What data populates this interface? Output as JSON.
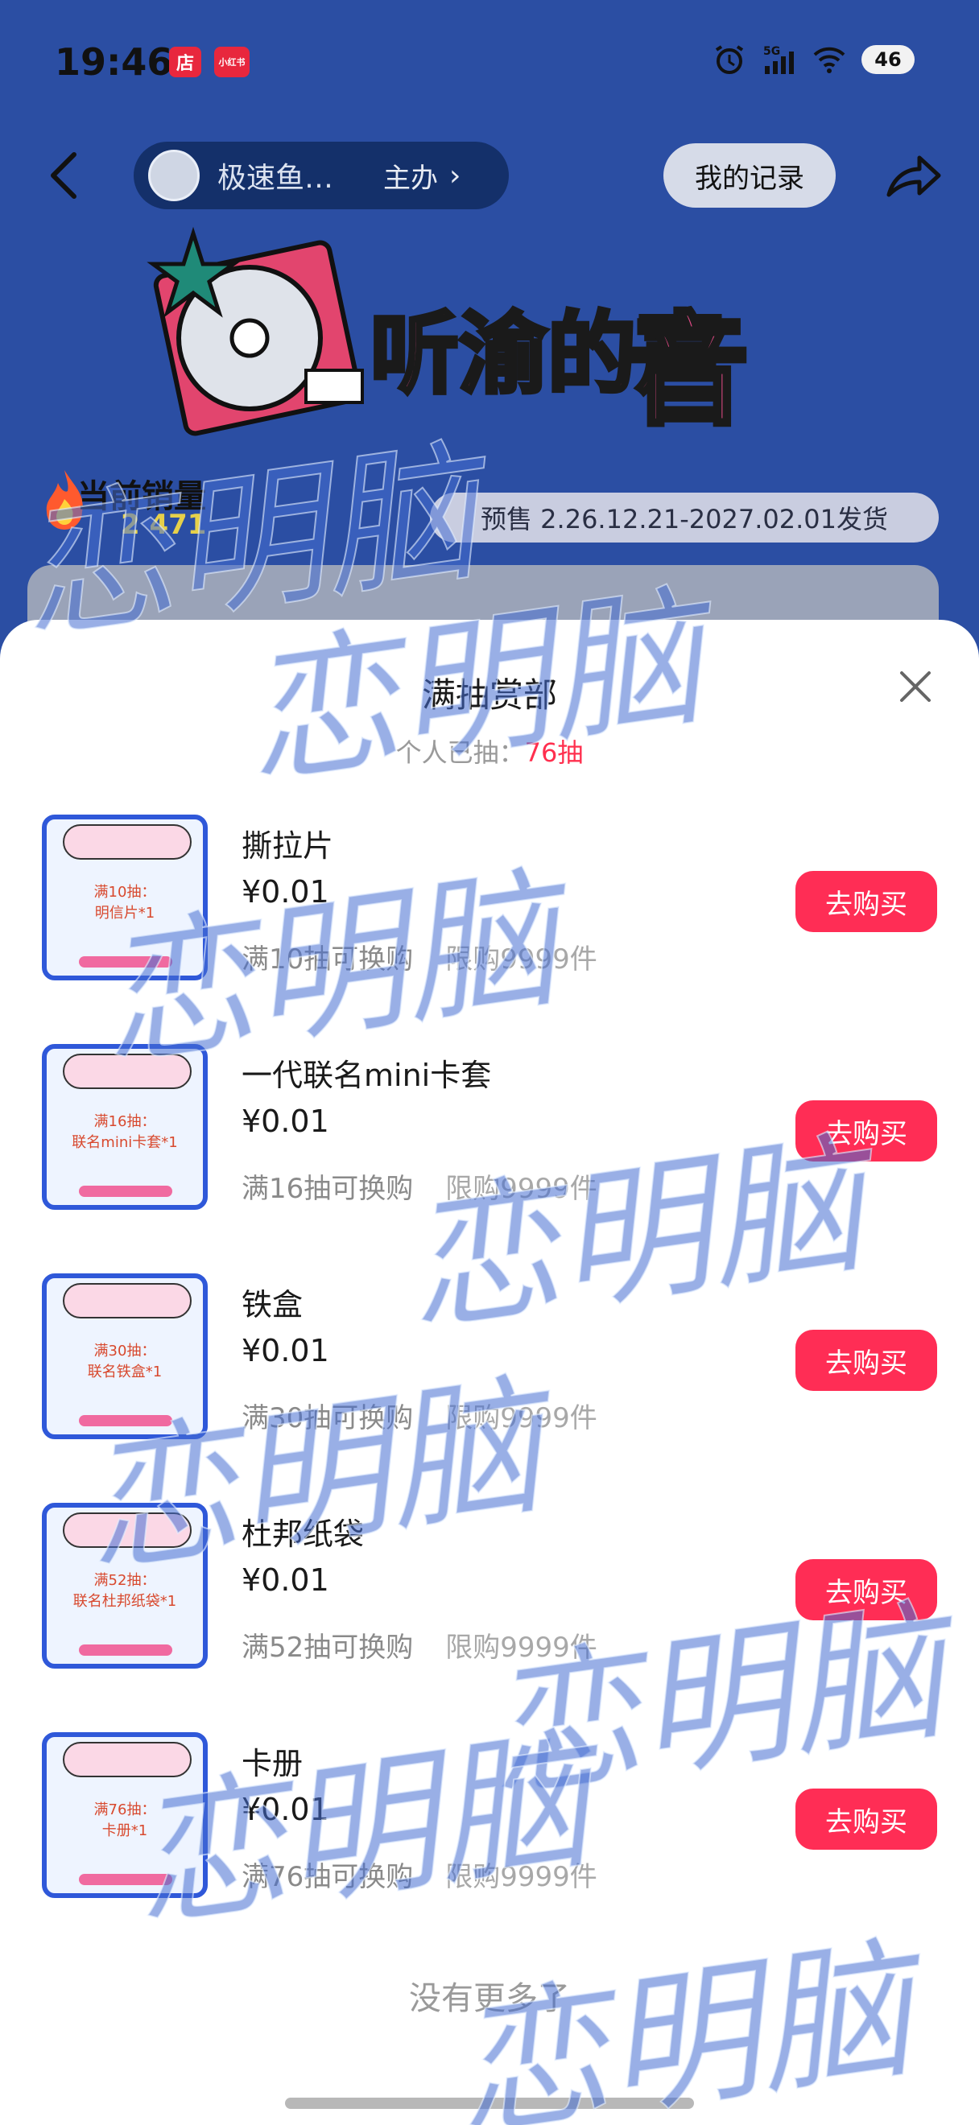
{
  "status_bar": {
    "time": "19:46",
    "badge1": "店",
    "badge2": "小红书",
    "network": "5G",
    "battery": "46"
  },
  "header": {
    "host_name": "极速鱼…",
    "host_tag": "主办",
    "record_button": "我的记录"
  },
  "banner": {
    "title_small": "听渝的声",
    "title_big": "音",
    "sales_label": "当前销量",
    "sales_value": "2 471",
    "presale_text": "预售 2.26.12.21-2027.02.01发货"
  },
  "sheet": {
    "title": "满抽赏部",
    "subtitle_prefix": "个人已抽：",
    "subtitle_count": "76抽",
    "no_more": "没有更多了"
  },
  "items": [
    {
      "name": "撕拉片",
      "price": "¥0.01",
      "condition": "满10抽可换购",
      "limit": "限购9999件",
      "buy": "去购买",
      "thumb_text": "满10抽：\n明信片*1"
    },
    {
      "name": "一代联名mini卡套",
      "price": "¥0.01",
      "condition": "满16抽可换购",
      "limit": "限购9999件",
      "buy": "去购买",
      "thumb_text": "满16抽：\n联名mini卡套*1"
    },
    {
      "name": "铁盒",
      "price": "¥0.01",
      "condition": "满30抽可换购",
      "limit": "限购9999件",
      "buy": "去购买",
      "thumb_text": "满30抽：\n联名铁盒*1"
    },
    {
      "name": "杜邦纸袋",
      "price": "¥0.01",
      "condition": "满52抽可换购",
      "limit": "限购9999件",
      "buy": "去购买",
      "thumb_text": "满52抽：\n联名杜邦纸袋*1"
    },
    {
      "name": "卡册",
      "price": "¥0.01",
      "condition": "满76抽可换购",
      "limit": "限购9999件",
      "buy": "去购买",
      "thumb_text": "满76抽：\n卡册*1"
    }
  ],
  "watermark": {
    "text": "恋明脑"
  }
}
